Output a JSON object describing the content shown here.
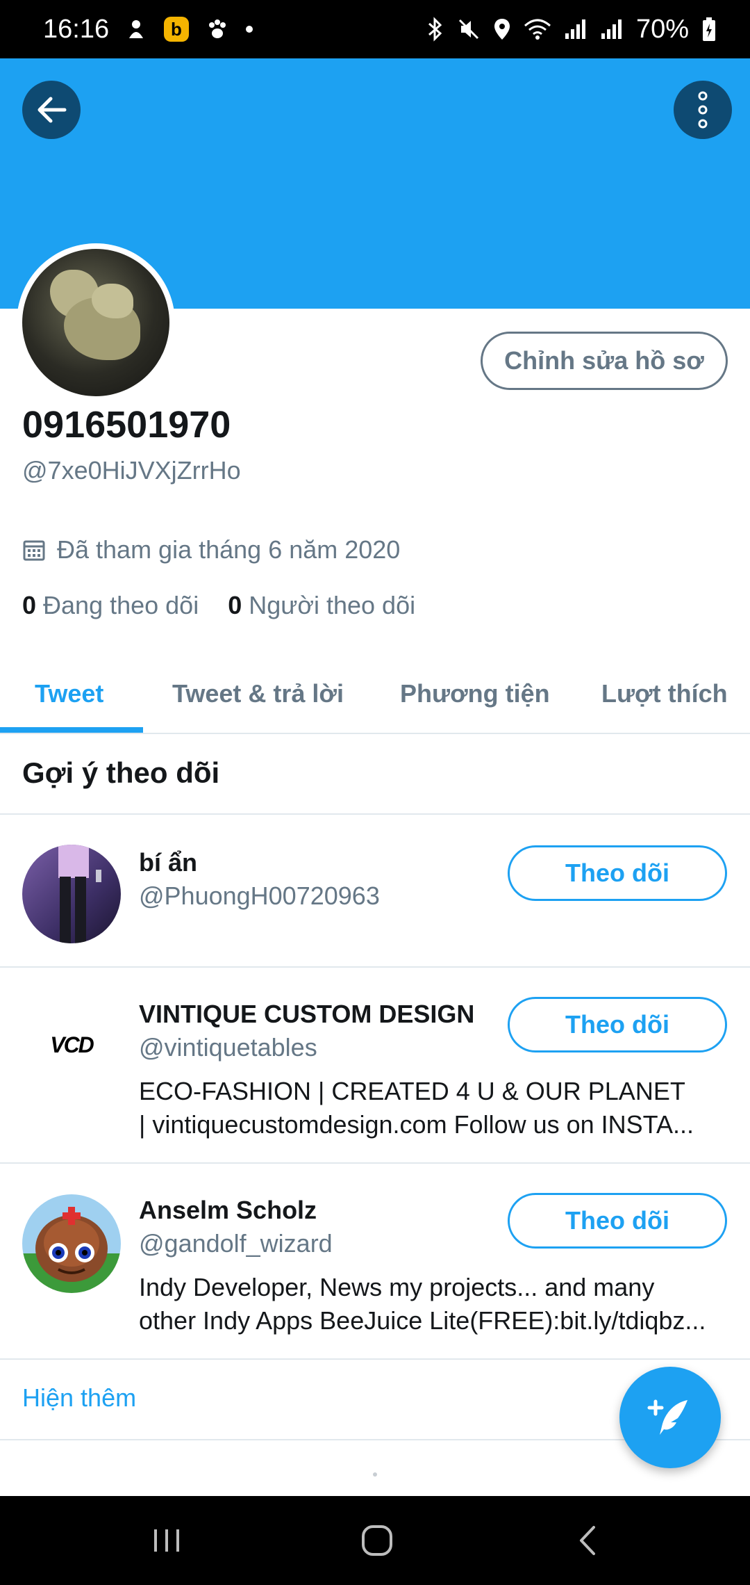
{
  "status_bar": {
    "time": "16:16",
    "battery": "70%"
  },
  "profile": {
    "display_name": "0916501970",
    "handle": "@7xe0HiJVXjZrrHo",
    "edit_button": "Chỉnh sửa hồ sơ",
    "joined": "Đã tham gia tháng 6 năm 2020",
    "following_count": "0",
    "following_label": "Đang theo dõi",
    "followers_count": "0",
    "followers_label": "Người theo dõi"
  },
  "tabs": [
    {
      "label": "Tweet",
      "active": true
    },
    {
      "label": "Tweet & trả lời",
      "active": false
    },
    {
      "label": "Phương tiện",
      "active": false
    },
    {
      "label": "Lượt thích",
      "active": false
    }
  ],
  "suggestions": {
    "title": "Gợi ý theo dõi",
    "users": [
      {
        "name": "bí ẩn",
        "handle": "@PhuongH00720963",
        "bio_lines": [],
        "follow_label": "Theo dõi"
      },
      {
        "name": "VINTIQUE CUSTOM DESIGN",
        "handle": "@vintiquetables",
        "bio_lines": [
          "ECO-FASHION | CREATED 4 U & OUR PLANET",
          "| vintiquecustomdesign.com Follow us on INSTA..."
        ],
        "follow_label": "Theo dõi",
        "logo_text": "VCD"
      },
      {
        "name": "Anselm Scholz",
        "handle": "@gandolf_wizard",
        "bio_lines": [
          "Indy Developer, News my projects... and many",
          "other Indy Apps BeeJuice Lite(FREE):bit.ly/tdiqbz..."
        ],
        "follow_label": "Theo dõi"
      }
    ],
    "show_more": "Hiện thêm"
  },
  "colors": {
    "accent": "#1da1f2",
    "muted": "#657786",
    "text": "#14171a"
  },
  "icons": {
    "back": "arrow-left-icon",
    "more": "more-vertical-icon",
    "calendar": "calendar-icon",
    "compose": "compose-tweet-icon"
  }
}
